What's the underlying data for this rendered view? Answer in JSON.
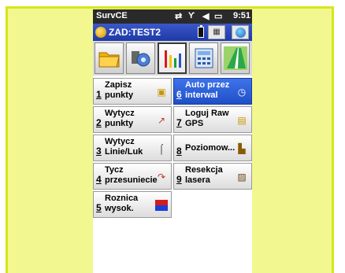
{
  "status_bar": {
    "app_name": "SurvCE",
    "time": "9:51"
  },
  "title_bar": {
    "title": "ZAD:TEST2"
  },
  "tabs": [
    {
      "icon": "folder-icon"
    },
    {
      "icon": "settings-gear-icon"
    },
    {
      "icon": "survey-stakeout-icon",
      "active": true
    },
    {
      "icon": "calculator-icon"
    },
    {
      "icon": "road-icon"
    }
  ],
  "menu": [
    {
      "num": "1",
      "label": "Zapisz\npunkty",
      "icon": "store-points-icon"
    },
    {
      "num": "6",
      "label": "Auto przez\ninterwal",
      "icon": "auto-interval-icon",
      "selected": true
    },
    {
      "num": "2",
      "label": "Wytycz\npunkty",
      "icon": "stake-points-icon"
    },
    {
      "num": "7",
      "label": "Loguj Raw\nGPS",
      "icon": "log-raw-gps-icon"
    },
    {
      "num": "3",
      "label": "Wytycz\nLinie/Luk",
      "icon": "stake-line-arc-icon"
    },
    {
      "num": "8",
      "label": "Poziomow...",
      "icon": "leveling-icon"
    },
    {
      "num": "4",
      "label": "Tycz\nprzesuniecie",
      "icon": "offset-stake-icon"
    },
    {
      "num": "9",
      "label": "Resekcja\nlasera",
      "icon": "laser-resection-icon"
    },
    {
      "num": "5",
      "label": "Roznica\nwysok.",
      "icon": "elevation-difference-icon"
    }
  ]
}
